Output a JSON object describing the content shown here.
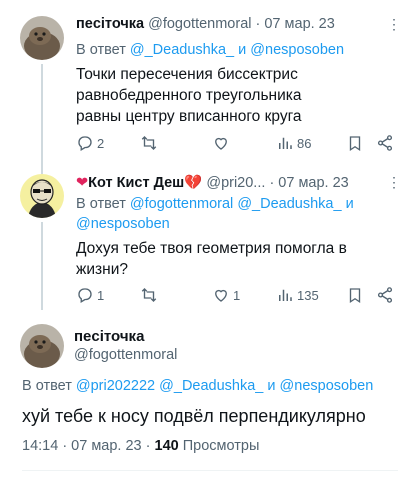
{
  "colors": {
    "link": "#1d9bf0",
    "muted": "#536471",
    "text": "#0f1419",
    "border": "#eff3f4"
  },
  "tweet1": {
    "name": "пeсiточка",
    "handle": "@fogottenmoral",
    "date": "· 07 мар. 23",
    "reply_prefix": "В ответ",
    "reply_user1": "@_Deadushka_",
    "reply_and": "и",
    "reply_user2": "@nesposoben",
    "text": "Точки пересечения биссектрис равнобедренного треугольника равны центру вписанного круга",
    "replies": "2",
    "retweets": "",
    "likes": "",
    "views": "86",
    "more": "⋮"
  },
  "tweet2": {
    "name": "Кот Кист Деш",
    "handle": "@pri20...",
    "date": "· 07 мар. 23",
    "reply_prefix": "В ответ",
    "reply_user1": "@fogottenmoral",
    "reply_user2": "@_Deadushka_",
    "reply_and": "и",
    "reply_user3": "@nesposoben",
    "text": "Дохуя тебе твоя геометрия помогла в жизни?",
    "replies": "1",
    "retweets": "",
    "likes": "1",
    "views": "135",
    "more": "⋮"
  },
  "main": {
    "name": "пeсiточка",
    "handle": "@fogottenmoral",
    "reply_prefix": "В ответ",
    "reply_user1": "@pri202222",
    "reply_user2": "@_Deadushka_",
    "reply_and": "и",
    "reply_user3": "@nesposoben",
    "text": "хуй тебе к носу подвёл перпендикулярно",
    "time": "14:14 · 07 мар. 23 ·",
    "views_count": "140",
    "views_label": "Просмотры"
  }
}
